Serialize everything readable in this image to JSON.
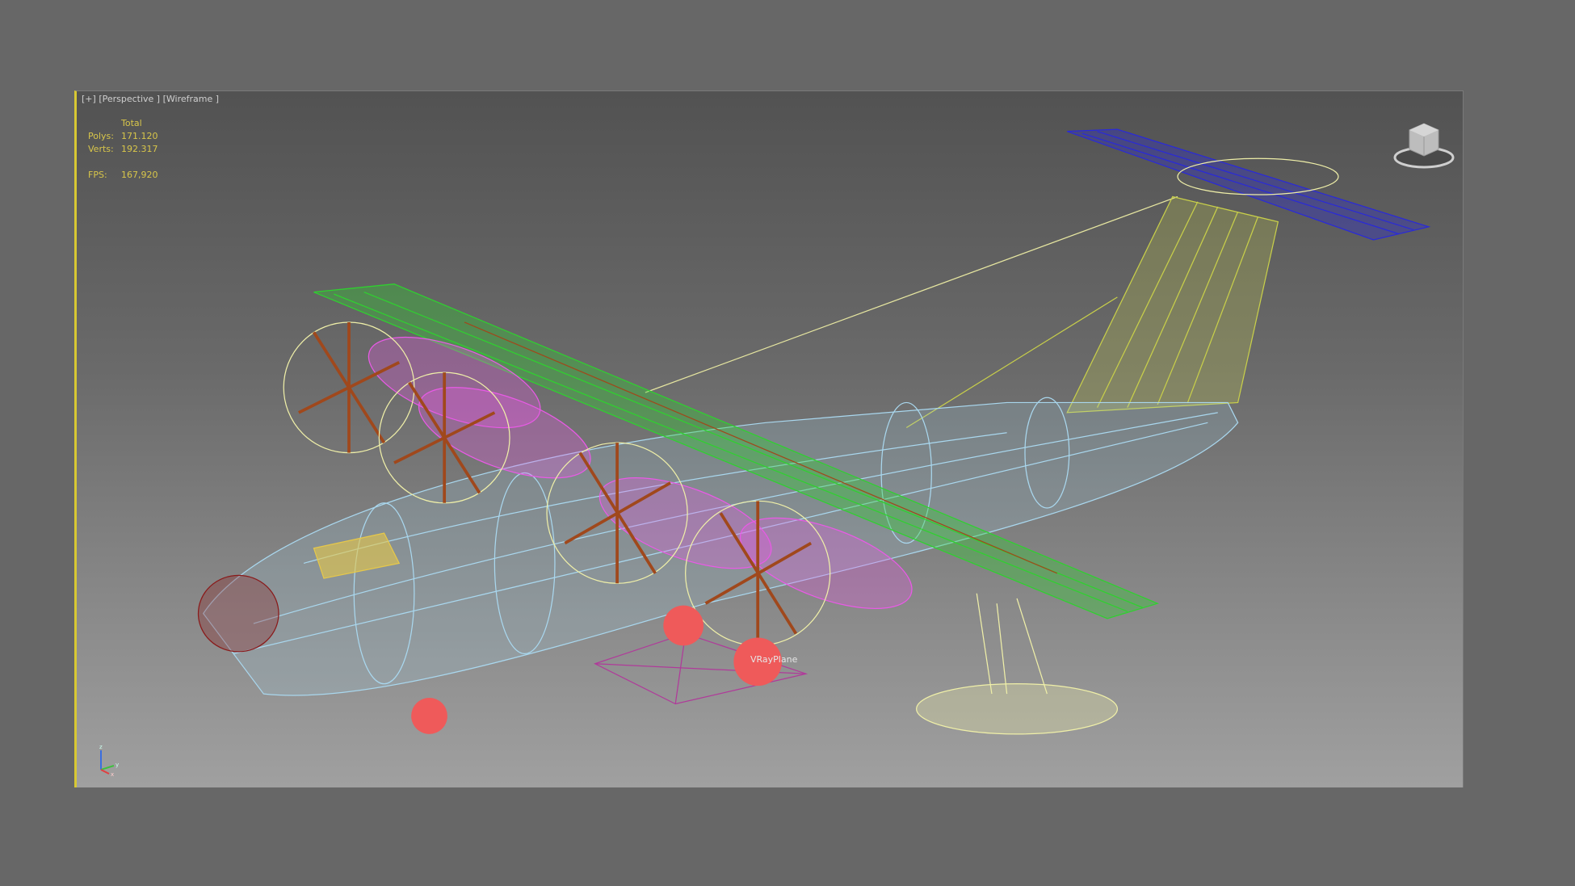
{
  "viewport": {
    "menu_label": "[+]",
    "view_label": "[Perspective ]",
    "shading_label": "[Wireframe ]",
    "stats": {
      "header": "Total",
      "polys_label": "Polys:",
      "polys_value": "171.120",
      "verts_label": "Verts:",
      "verts_value": "192.317",
      "fps_label": "FPS:",
      "fps_value": "167,920"
    },
    "scene_object_label": "VRayPlane",
    "axis_labels": {
      "z": "z",
      "y": "y",
      "x": "x"
    }
  },
  "colors": {
    "stats_text": "#d8c64a",
    "wire_body": "#a9d7ee",
    "wire_wing": "#2fd12f",
    "wire_engine": "#e95ae6",
    "wire_stab": "#2a2ad8",
    "wire_fin": "#c8cf4a",
    "wire_float": "#efefa8",
    "wire_nose": "#8a1a1a",
    "prop": "#a0481c",
    "wheel": "#ef5a5a"
  }
}
